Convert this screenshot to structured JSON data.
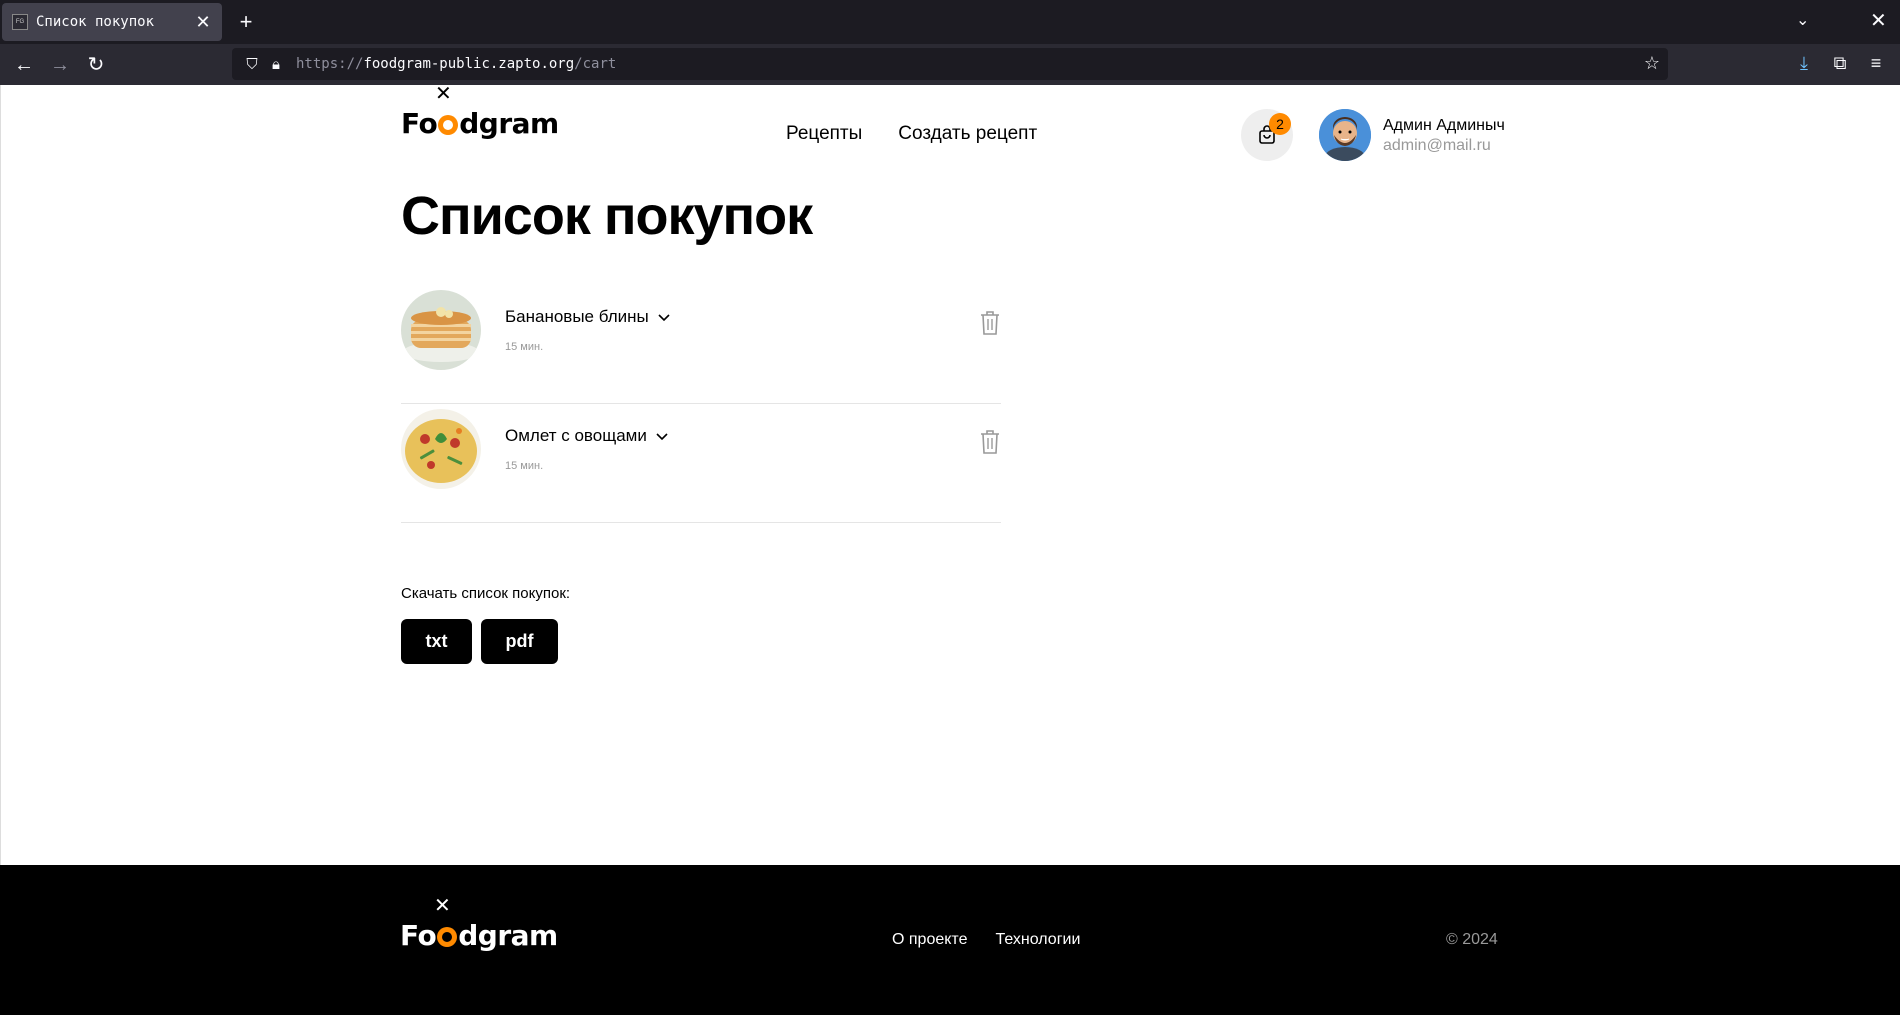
{
  "browser": {
    "tab_title": "Список покупок",
    "tab_favicon_text": "FG",
    "url_scheme": "https://",
    "url_host": "foodgram-public.zapto.org",
    "url_path": "/cart"
  },
  "header": {
    "logo_text_prefix": "Fo",
    "logo_text_suffix": "dgram",
    "nav": [
      {
        "label": "Рецепты"
      },
      {
        "label": "Создать рецепт"
      }
    ],
    "cart_count": "2",
    "user_name": "Админ Админыч",
    "user_email": "admin@mail.ru"
  },
  "main": {
    "title": "Список покупок",
    "items": [
      {
        "name": "Банановые блины",
        "time": "15 мин."
      },
      {
        "name": "Омлет с овощами",
        "time": "15 мин."
      }
    ],
    "download_label": "Скачать список покупок:",
    "download_txt": "txt",
    "download_pdf": "pdf"
  },
  "footer": {
    "nav": [
      {
        "label": "О проекте"
      },
      {
        "label": "Технологии"
      }
    ],
    "copyright": "© 2024"
  },
  "colors": {
    "accent": "#ff8a00",
    "chrome_dark": "#1c1b22",
    "chrome_mid": "#2b2a33"
  }
}
